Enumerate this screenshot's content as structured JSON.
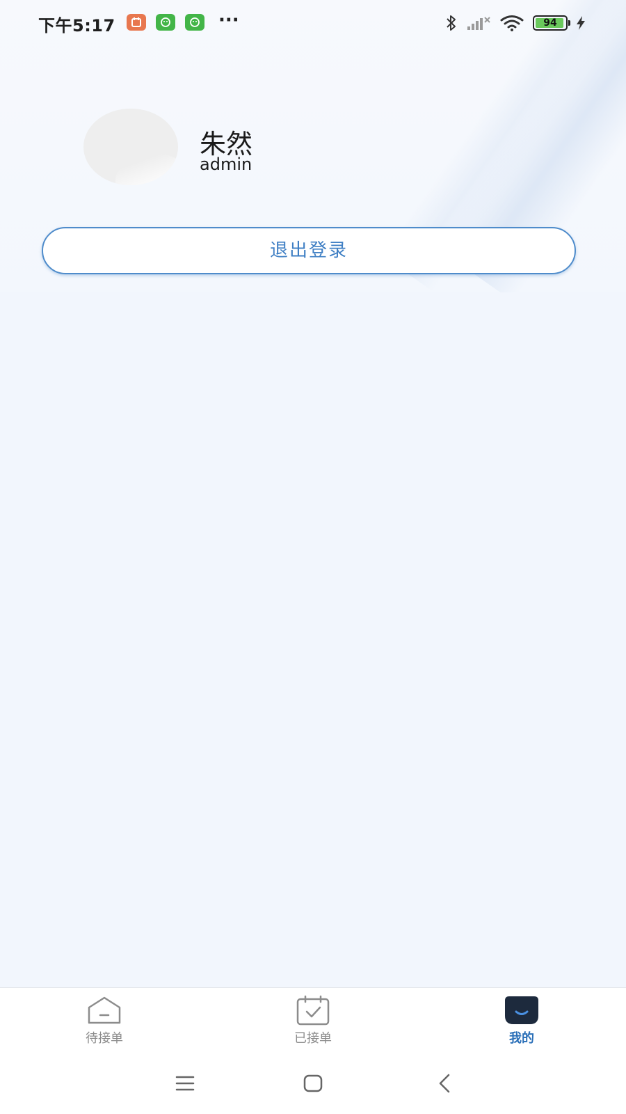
{
  "status_bar": {
    "time": "下午5:17",
    "more": "···",
    "battery": "94",
    "icons": [
      "calendar-notification-icon",
      "wechat-icon",
      "wechat-icon",
      "bluetooth-icon",
      "signal-icon",
      "wifi-icon",
      "battery-icon",
      "charging-icon"
    ]
  },
  "profile": {
    "name": "朱然",
    "account": "admin"
  },
  "logout_label": "退出登录",
  "tabs": [
    {
      "label": "待接单",
      "icon": "pending-orders-icon",
      "active": false
    },
    {
      "label": "已接单",
      "icon": "accepted-orders-icon",
      "active": false
    },
    {
      "label": "我的",
      "icon": "profile-icon",
      "active": true
    }
  ],
  "nav": {
    "icons": [
      "menu-icon",
      "home-icon",
      "back-icon"
    ]
  },
  "colors": {
    "accent": "#3f7fc4",
    "active_tab": "#2a6fb8",
    "inactive_tab": "#8c8c8c",
    "background": "#f2f6fd"
  }
}
